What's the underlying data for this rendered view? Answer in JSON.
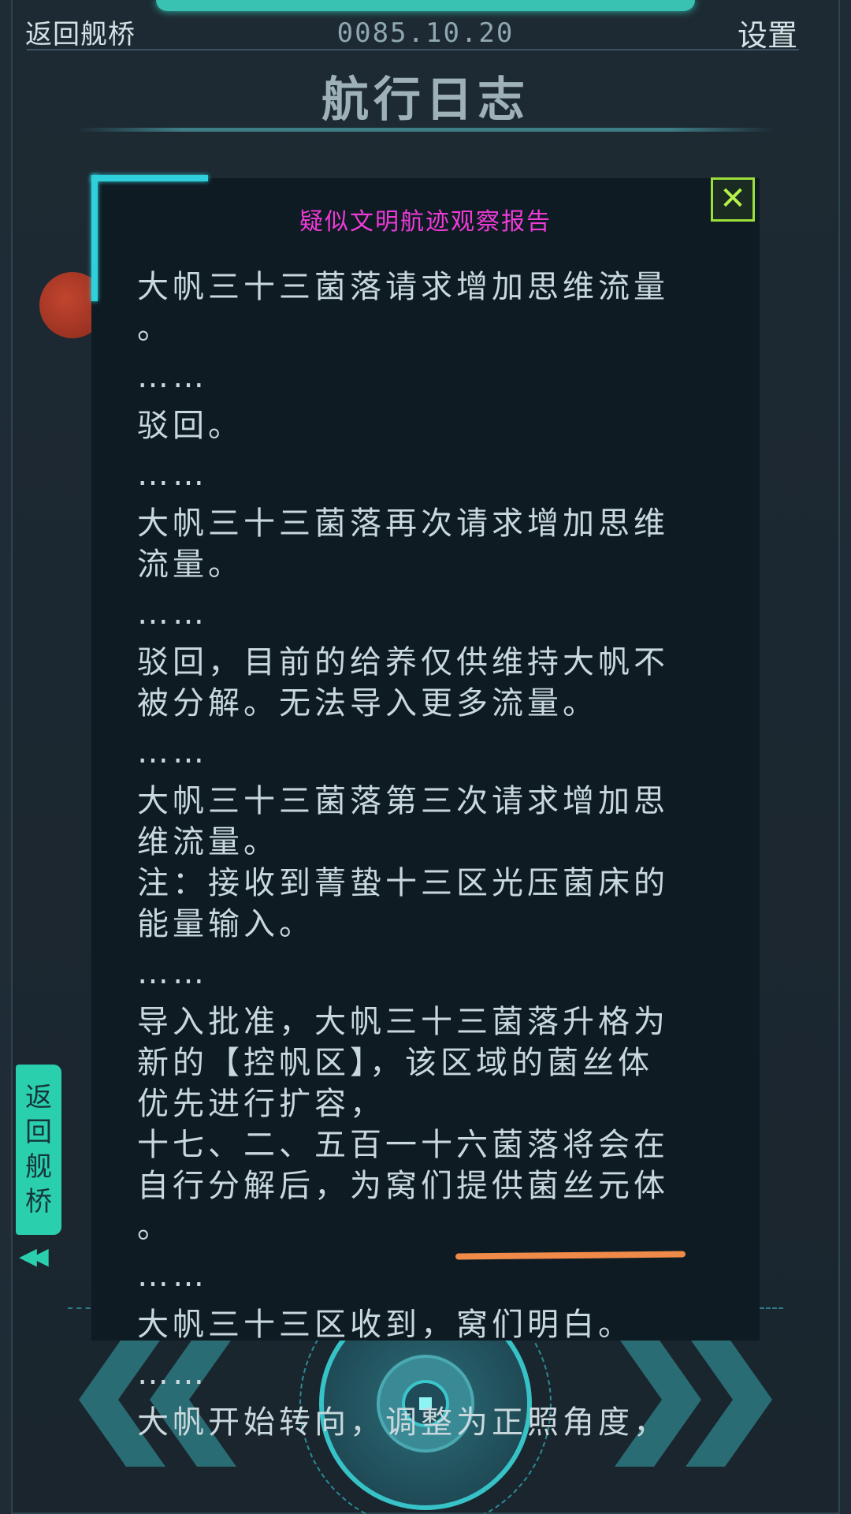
{
  "header": {
    "back_label": "返回舰桥",
    "date": "0085.10.20",
    "settings_label": "设置",
    "page_title": "航行日志"
  },
  "report": {
    "title": "疑似文明航迹观察报告",
    "close_symbol": "✕",
    "lines": [
      "大帆三十三菌落请求增加思维流量",
      "。",
      "……",
      "驳回。",
      "……",
      "大帆三十三菌落再次请求增加思维",
      "流量。",
      "……",
      "驳回，目前的给养仅供维持大帆不",
      "被分解。无法导入更多流量。",
      "……",
      "大帆三十三菌落第三次请求增加思",
      "维流量。",
      "注：接收到菁蛰十三区光压菌床的",
      "能量输入。",
      "……",
      "导入批准，大帆三十三菌落升格为",
      "新的【控帆区】，该区域的菌丝体",
      "优先进行扩容，",
      "十七、二、五百一十六菌落将会在",
      "自行分解后，为窝们提供菌丝元体",
      "。",
      "……",
      "大帆三十三区收到，窝们明白。",
      "……",
      "大帆开始转向，调整为正照角度，"
    ]
  },
  "side_tab": {
    "chars": [
      "返",
      "回",
      "舰",
      "桥"
    ],
    "arrows": "◀◀"
  },
  "colors": {
    "accent": "#2ad0ae",
    "report_title": "#ee3bd8",
    "close": "#9be03a",
    "highlight": "#f08a48"
  }
}
